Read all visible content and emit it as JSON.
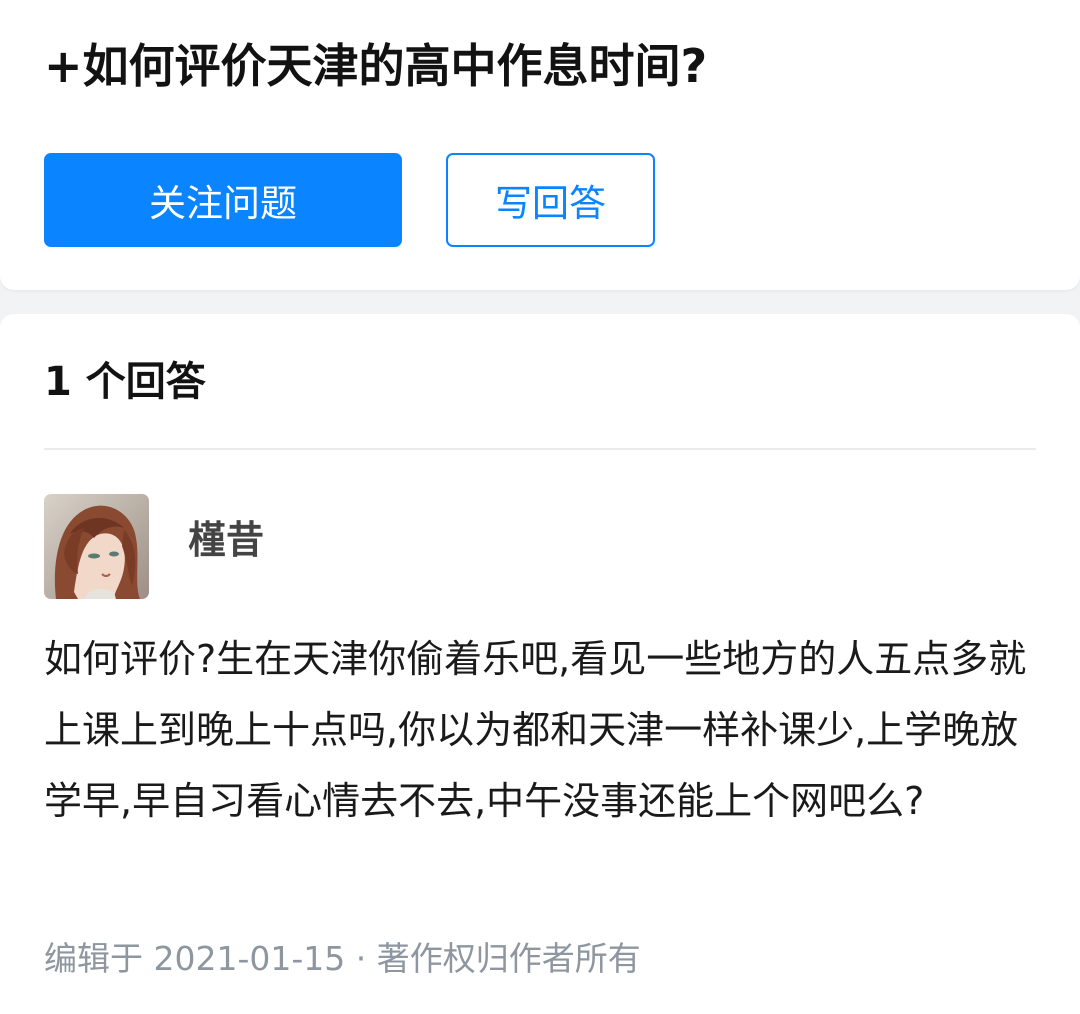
{
  "question": {
    "title": "+如何评价天津的高中作息时间?",
    "follow_button": "关注问题",
    "write_answer_button": "写回答"
  },
  "answers": {
    "count_label": "1 个回答",
    "items": [
      {
        "author": "槿昔",
        "avatar_icon": "anime-girl-avatar",
        "content": "如何评价?生在天津你偷着乐吧,看见一些地方的人五点多就上课上到晚上十点吗,你以为都和天津一样补课少,上学晚放学早,早自习看心情去不去,中午没事还能上个网吧么?",
        "meta": "编辑于 2021-01-15 · 著作权归作者所有"
      }
    ]
  },
  "colors": {
    "accent": "#0a84ff",
    "meta_text": "#8e96a0",
    "background": "#f2f3f5"
  }
}
